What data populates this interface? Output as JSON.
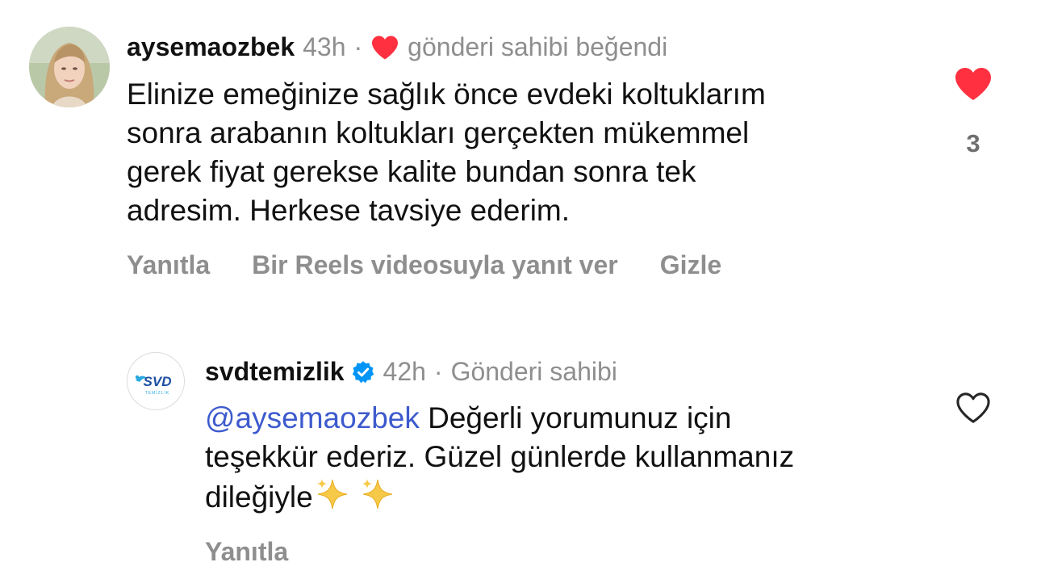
{
  "comment": {
    "username": "aysemaozbek",
    "time": "43h",
    "separator": "·",
    "liked_note": "gönderi sahibi beğendi",
    "lines": [
      "Elinize emeğinize sağlık önce evdeki koltuklarım",
      "sonra arabanın koltukları gerçekten mükemmel",
      "gerek fiyat gerekse kalite bundan sonra tek",
      "adresim. Herkese tavsiye ederim."
    ],
    "actions": {
      "reply": "Yanıtla",
      "reels_reply": "Bir Reels videosuyla yanıt ver",
      "hide": "Gizle"
    },
    "like_count": "3",
    "liked": true
  },
  "reply": {
    "username": "svdtemizlik",
    "verified": true,
    "time": "42h",
    "separator": "·",
    "role": "Gönderi sahibi",
    "mention": "@aysemaozbek",
    "line1_rest": " Değerli yorumunuz için",
    "line2": "teşekkür ederiz. Güzel günlerde kullanmanız",
    "line3": "dileğiyle",
    "logo_text": "SVD",
    "logo_sub": "TEMİZLİK",
    "actions": {
      "reply": "Yanıtla"
    },
    "liked": false
  },
  "colors": {
    "heart_red": "#ff3040",
    "verified_blue": "#0095f6",
    "mention_blue": "#3d5acd",
    "muted_gray": "#8e8e8e"
  },
  "icons": [
    "heart-filled-icon",
    "heart-outline-icon",
    "verified-badge-icon",
    "sparkles-icon"
  ]
}
